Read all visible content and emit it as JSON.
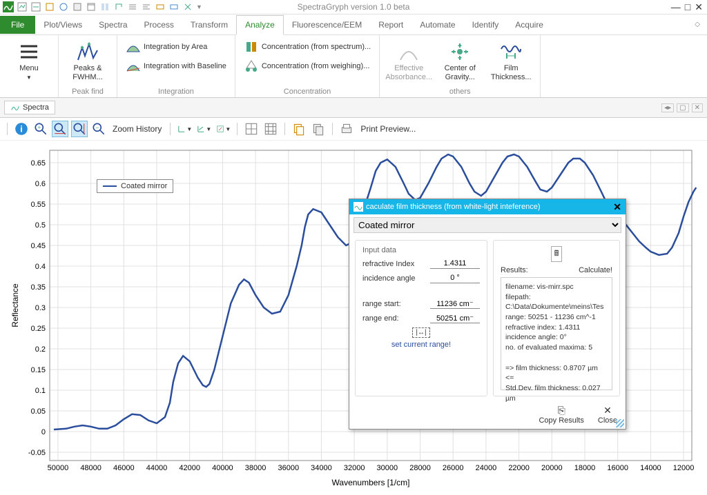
{
  "window": {
    "title": "SpectraGryph version 1.0 beta"
  },
  "tabs": {
    "file": "File",
    "items": [
      "Plot/Views",
      "Spectra",
      "Process",
      "Transform",
      "Analyze",
      "Fluorescence/EEM",
      "Report",
      "Automate",
      "Identify",
      "Acquire"
    ],
    "active_index": 4
  },
  "ribbon": {
    "menu": {
      "label": "Menu",
      "sub": "▼"
    },
    "groups": [
      {
        "label": "Peak find",
        "big": [
          {
            "label": "Peaks & FWHM..."
          }
        ]
      },
      {
        "label": "Integration",
        "small": [
          {
            "label": "Integration by Area"
          },
          {
            "label": "Integration with Baseline"
          }
        ]
      },
      {
        "label": "Concentration",
        "small": [
          {
            "label": "Concentration (from spectrum)..."
          },
          {
            "label": "Concentration (from weighing)..."
          }
        ]
      },
      {
        "label": "others",
        "big": [
          {
            "label": "Effective Absorbance..."
          },
          {
            "label": "Center of Gravity..."
          },
          {
            "label": "Film Thickness..."
          }
        ]
      }
    ]
  },
  "doc": {
    "tab_label": "Spectra"
  },
  "toolbar": {
    "zoom_history": "Zoom History",
    "print_preview": "Print Preview..."
  },
  "legend": {
    "series": "Coated mirror"
  },
  "chart_data": {
    "type": "line",
    "title": "",
    "xlabel": "Wavenumbers [1/cm]",
    "ylabel": "Reflectance",
    "xlim": [
      50500,
      11500
    ],
    "ylim": [
      -0.07,
      0.68
    ],
    "xticks": [
      50000,
      48000,
      46000,
      44000,
      42000,
      40000,
      38000,
      36000,
      34000,
      32000,
      30000,
      28000,
      26000,
      24000,
      22000,
      20000,
      18000,
      16000,
      14000,
      12000
    ],
    "yticks": [
      -0.05,
      0,
      0.05,
      0.1,
      0.15,
      0.2,
      0.25,
      0.3,
      0.35,
      0.4,
      0.45,
      0.5,
      0.55,
      0.6,
      0.65
    ],
    "series": [
      {
        "name": "Coated mirror",
        "color": "#2a4d9c",
        "x": [
          50251,
          49500,
          49000,
          48500,
          48000,
          47500,
          47000,
          46500,
          46000,
          45500,
          45000,
          44500,
          44000,
          43500,
          43200,
          43000,
          42700,
          42400,
          42000,
          41500,
          41200,
          41000,
          40800,
          40500,
          40000,
          39500,
          39000,
          38700,
          38400,
          38000,
          37500,
          37000,
          36500,
          36000,
          35500,
          35200,
          35000,
          34800,
          34500,
          34000,
          33500,
          33000,
          32500,
          32000,
          31700,
          31400,
          31000,
          30700,
          30400,
          30000,
          29500,
          29000,
          28700,
          28300,
          28000,
          27500,
          27000,
          26700,
          26300,
          26000,
          25500,
          25000,
          24700,
          24300,
          24000,
          23500,
          23000,
          22700,
          22300,
          22000,
          21500,
          21000,
          20700,
          20300,
          20000,
          19500,
          19000,
          18700,
          18300,
          18000,
          17500,
          17000,
          16700,
          16300,
          16000,
          15500,
          15000,
          14700,
          14300,
          14000,
          13500,
          13000,
          12700,
          12300,
          12000,
          11700,
          11400,
          11236
        ],
        "y": [
          0.005,
          0.007,
          0.012,
          0.015,
          0.012,
          0.007,
          0.007,
          0.015,
          0.03,
          0.042,
          0.04,
          0.027,
          0.02,
          0.035,
          0.07,
          0.12,
          0.165,
          0.183,
          0.17,
          0.13,
          0.112,
          0.108,
          0.115,
          0.15,
          0.23,
          0.31,
          0.355,
          0.368,
          0.36,
          0.33,
          0.3,
          0.285,
          0.29,
          0.33,
          0.4,
          0.45,
          0.495,
          0.525,
          0.538,
          0.53,
          0.5,
          0.47,
          0.45,
          0.46,
          0.49,
          0.54,
          0.59,
          0.63,
          0.65,
          0.658,
          0.64,
          0.6,
          0.575,
          0.56,
          0.565,
          0.6,
          0.64,
          0.66,
          0.67,
          0.665,
          0.64,
          0.6,
          0.58,
          0.57,
          0.58,
          0.615,
          0.65,
          0.665,
          0.67,
          0.665,
          0.64,
          0.605,
          0.585,
          0.58,
          0.59,
          0.62,
          0.65,
          0.66,
          0.66,
          0.65,
          0.62,
          0.58,
          0.555,
          0.535,
          0.52,
          0.5,
          0.475,
          0.46,
          0.445,
          0.435,
          0.427,
          0.43,
          0.445,
          0.48,
          0.52,
          0.555,
          0.58,
          0.59
        ]
      }
    ]
  },
  "dialog": {
    "title": "caculate film thickness (from white-light inteference)",
    "spectrum": "Coated mirror",
    "input_head": "Input data",
    "refr_label": "refractive Index",
    "refr_value": "1.4311",
    "ang_label": "incidence angle",
    "ang_value": "0 °",
    "start_label": "range start:",
    "start_value": "11236 cm⁻",
    "end_label": "range end:",
    "end_value": "50251 cm⁻",
    "set_range": "set current range!",
    "results_label": "Results:",
    "calc_button": "Calculate!",
    "results_text": "filename: vis-mirr.spc\nfilepath: C:\\Data\\Dokumente\\meins\\Tes\nrange:   50251 - 11236 cm^-1\nrefractive index: 1.4311\nincidence angle: 0°\nno. of evaluated maxima: 5\n\n=>  film thickness:  0.8707 µm  <=\nStd.Dev. film thickness: 0.027 µm",
    "copy": "Copy Results",
    "close": "Close"
  }
}
